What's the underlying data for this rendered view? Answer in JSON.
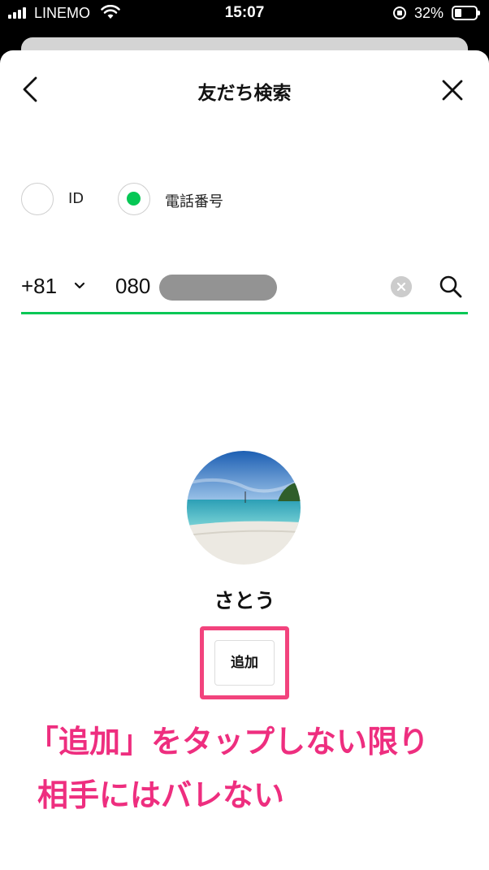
{
  "status_bar": {
    "carrier": "LINEMO",
    "time": "15:07",
    "battery": "32%",
    "icons": [
      "signal-icon",
      "wifi-icon",
      "orientation-lock-icon",
      "battery-icon"
    ]
  },
  "header": {
    "title": "友だち検索",
    "back_icon": "chevron-left-icon",
    "close_icon": "close-icon"
  },
  "search_type": {
    "options": [
      {
        "label": "ID",
        "selected": false
      },
      {
        "label": "電話番号",
        "selected": true
      }
    ]
  },
  "phone_input": {
    "country_code": "+81",
    "number_prefix": "080",
    "number_redacted": true,
    "underline_color": "#06c755"
  },
  "result": {
    "name": "さとう",
    "add_button": "追加"
  },
  "annotation": {
    "line1": "「追加」をタップしない限り",
    "line2": "相手にはバレない",
    "color": "#ee2e7f",
    "highlight_color": "#f2437d"
  },
  "colors": {
    "accent": "#06c755"
  }
}
